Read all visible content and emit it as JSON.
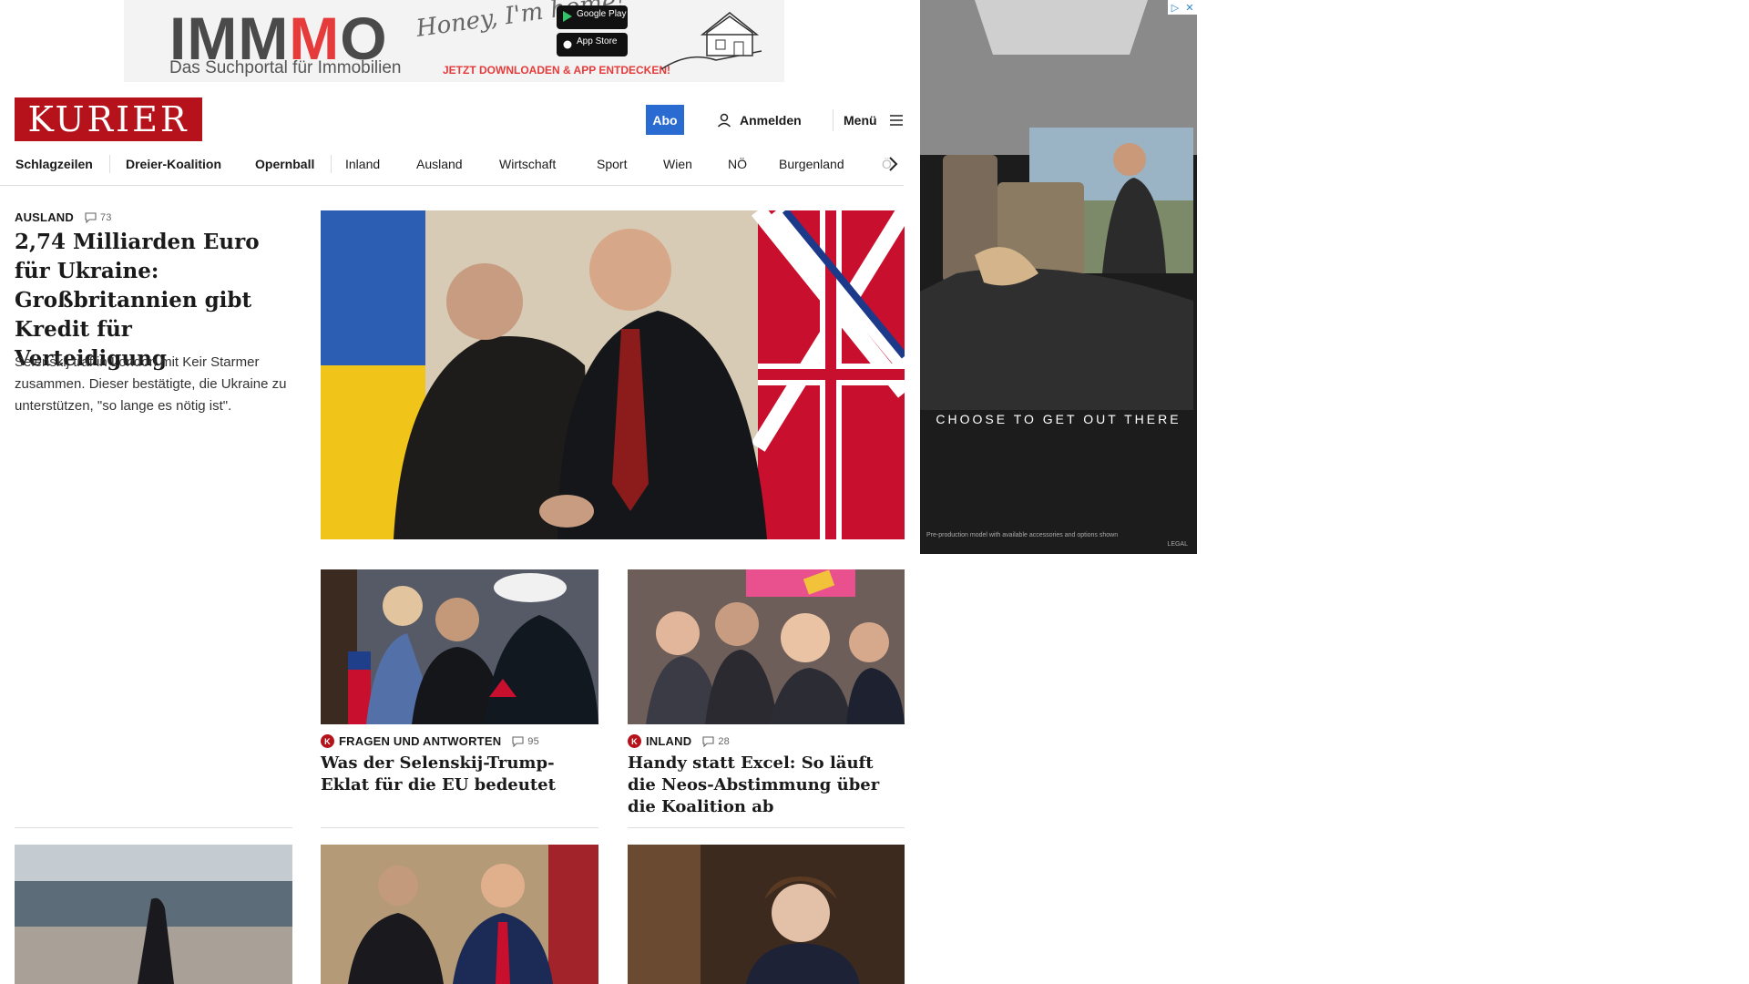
{
  "top_ad": {
    "brand_prefix": "IMM",
    "brand_red": "M",
    "brand_suffix": "O",
    "tagline": "Das Suchportal für Immobilien",
    "slogan": "Honey, I'm home!",
    "google_play": "Google Play",
    "app_store": "App Store",
    "cta": "JETZT DOWNLOADEN & APP ENTDECKEN!"
  },
  "header": {
    "logo": "KURIER",
    "abo": "Abo",
    "login": "Anmelden",
    "menu": "Menü"
  },
  "nav": {
    "items": [
      "Schlagzeilen",
      "Dreier-Koalition",
      "Opernball",
      "Inland",
      "Ausland",
      "Wirtschaft",
      "Sport",
      "Wien",
      "NÖ",
      "Burgenland",
      "Ö"
    ]
  },
  "lead": {
    "kicker": "AUSLAND",
    "comments": "73",
    "title": "2,74 Milliarden Euro für Ukraine: Großbritannien gibt Kredit für Verteidigung",
    "teaser": "Selenskij traf in London mit Keir Starmer zusammen. Dieser bestätigte, die Ukraine zu unterstützen, \"so lange es nötig ist\"."
  },
  "cards": [
    {
      "badge": "K",
      "kicker": "FRAGEN UND ANTWORTEN",
      "comments": "95",
      "title": "Was der Selenskij-Trump-Eklat für die EU bedeutet"
    },
    {
      "badge": "K",
      "kicker": "INLAND",
      "comments": "28",
      "title": "Handy statt Excel: So läuft die Neos-Abstimmung über die Koalition ab"
    }
  ],
  "side_ad": {
    "claim": "CHOOSE TO GET OUT THERE",
    "fine_print": "Pre-production model with available accessories and options shown",
    "legal": "LEGAL"
  },
  "colors": {
    "brand_red": "#b5121b",
    "abo_blue": "#2a6bd1"
  }
}
